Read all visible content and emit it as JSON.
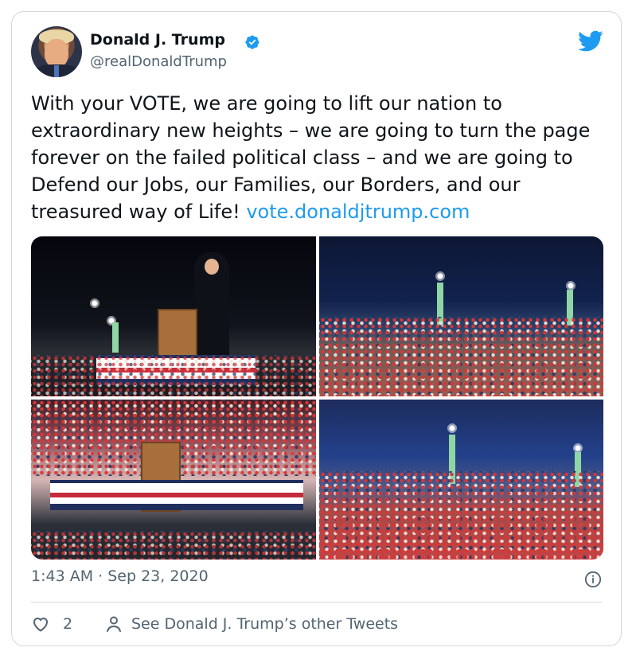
{
  "tweet": {
    "author": {
      "name": "Donald J. Trump",
      "handle": "@realDonaldTrump",
      "verified_icon": "verified-badge-icon",
      "avatar_icon": "profile-avatar"
    },
    "text": "With your VOTE, we are going to lift our nation to extraordinary new heights – we are going to turn the page forever on the failed political class – and we are going to Defend our Jobs, our Families, our Borders, and our treasured way of Life! ",
    "link_text": "vote.donaldjtrump.com",
    "timestamp": "1:43 AM · Sep 23, 2020",
    "likes": "2",
    "see_more": "See Donald J. Trump’s other Tweets"
  },
  "media": {
    "images": [
      {
        "name": "rally-image-speaker-stage"
      },
      {
        "name": "rally-image-night-crowd"
      },
      {
        "name": "rally-image-podium-crowd"
      },
      {
        "name": "rally-image-wide-crowd"
      }
    ]
  },
  "colors": {
    "accent": "#1d9bf0",
    "text": "#0f1419",
    "muted": "#536471",
    "border": "#cfd9de"
  },
  "icons": {
    "platform": "twitter-bird-icon",
    "info": "info-icon",
    "like": "heart-icon",
    "profile": "person-icon"
  }
}
